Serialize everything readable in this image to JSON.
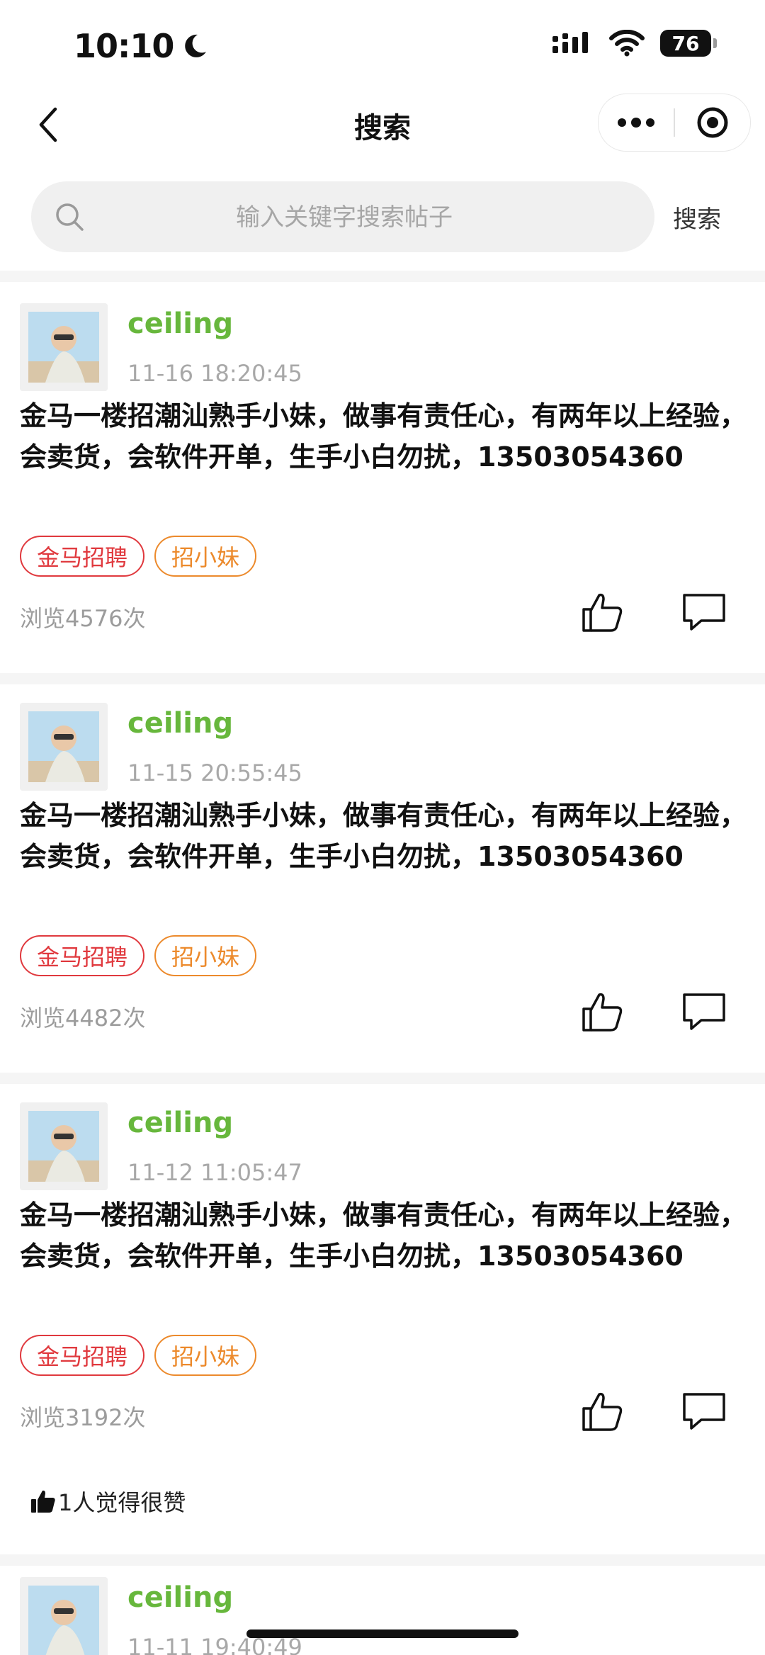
{
  "status": {
    "time": "10:10",
    "battery": "76"
  },
  "nav": {
    "title": "搜索"
  },
  "search": {
    "placeholder": "输入关键字搜索帖子",
    "button": "搜索"
  },
  "posts": [
    {
      "username": "ceiling",
      "time": "11-16 18:20:45",
      "content": "金马一楼招潮汕熟手小妹，做事有责任心，有两年以上经验，会卖货，会软件开单，生手小白勿扰，13503054360",
      "tags": [
        "金马招聘",
        "招小妹"
      ],
      "views": "浏览4576次"
    },
    {
      "username": "ceiling",
      "time": "11-15 20:55:45",
      "content": "金马一楼招潮汕熟手小妹，做事有责任心，有两年以上经验，会卖货，会软件开单，生手小白勿扰，13503054360",
      "tags": [
        "金马招聘",
        "招小妹"
      ],
      "views": "浏览4482次"
    },
    {
      "username": "ceiling",
      "time": "11-12 11:05:47",
      "content": "金马一楼招潮汕熟手小妹，做事有责任心，有两年以上经验，会卖货，会软件开单，生手小白勿扰，13503054360",
      "tags": [
        "金马招聘",
        "招小妹"
      ],
      "views": "浏览3192次",
      "liked_summary": "1人觉得很赞"
    },
    {
      "username": "ceiling",
      "time": "11-11 19:40:49"
    }
  ],
  "colors": {
    "username": "#67b73c",
    "tag_red": "#e0393e",
    "tag_orange": "#ec8a2c"
  }
}
